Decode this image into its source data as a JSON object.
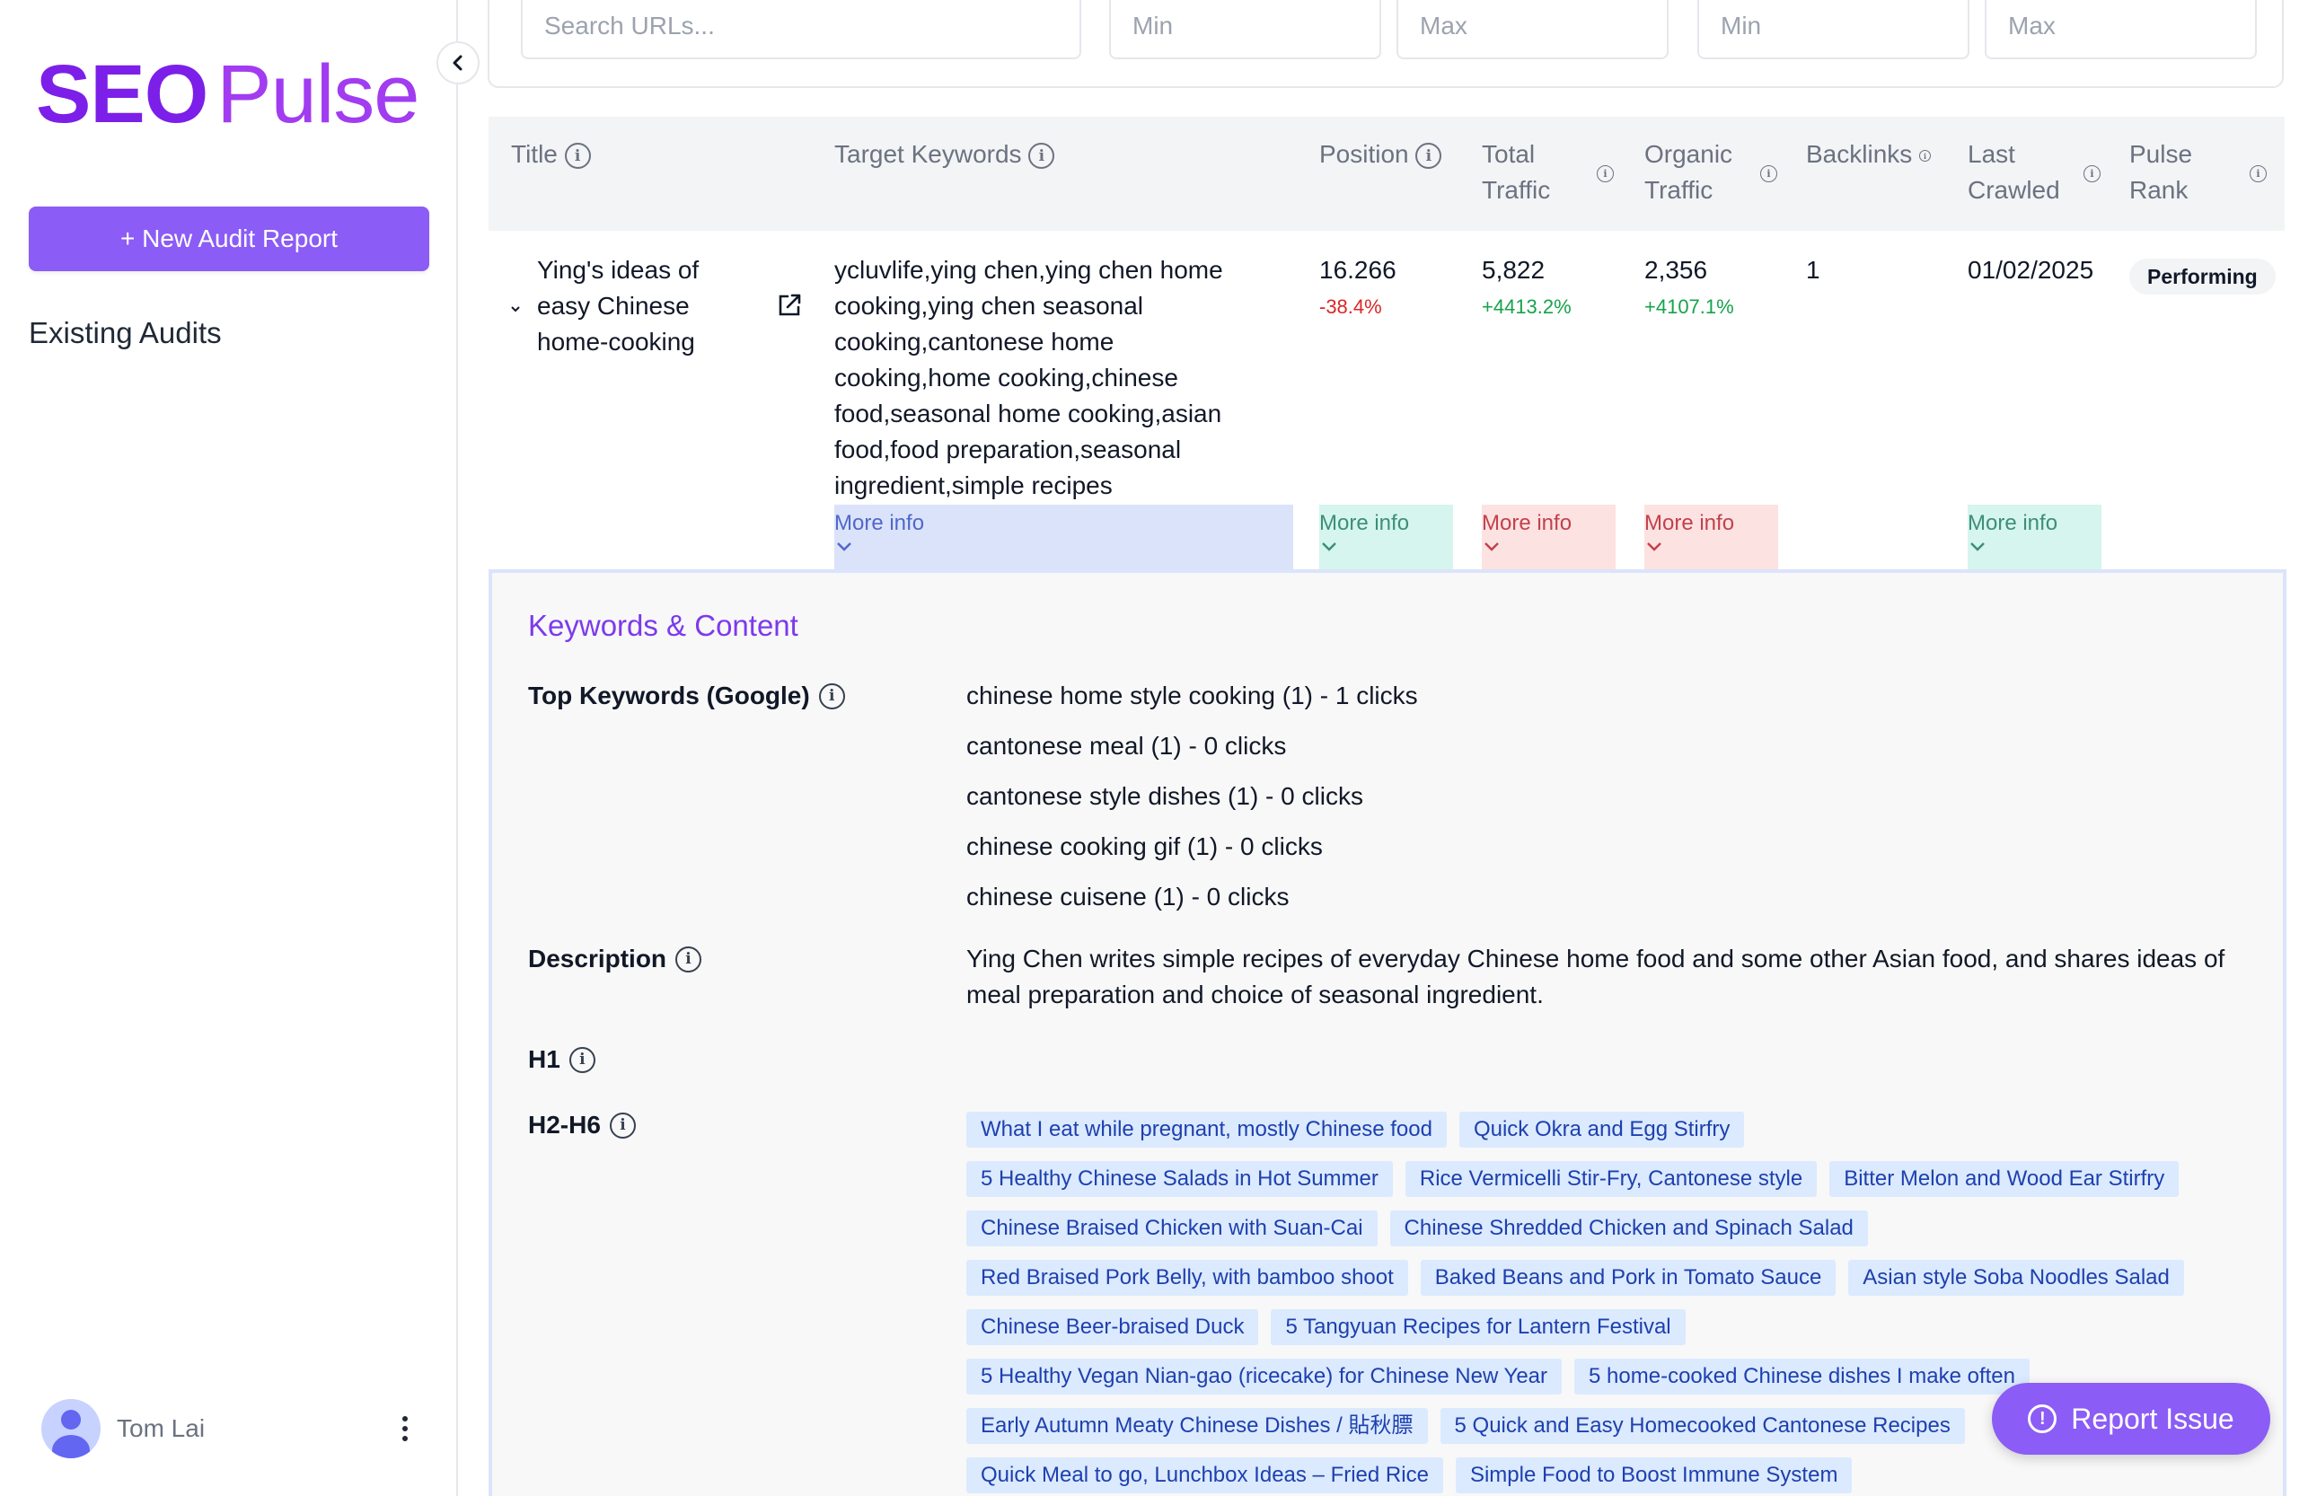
{
  "brand": {
    "name_bold": "SEO",
    "name_light": "Pulse",
    "primary": "#8b5cf6",
    "logo_color": "#7c1fe8"
  },
  "sidebar": {
    "new_audit_label": "+ New Audit Report",
    "existing_audits_label": "Existing Audits",
    "user_name": "Tom Lai"
  },
  "filters": {
    "search_placeholder": "Search URLs...",
    "min1_placeholder": "Min",
    "max1_placeholder": "Max",
    "min2_placeholder": "Min",
    "max2_placeholder": "Max"
  },
  "table": {
    "headers": {
      "title": "Title",
      "target_keywords": "Target Keywords",
      "position": "Position",
      "total_traffic": "Total Traffic",
      "organic_traffic": "Organic Traffic",
      "backlinks": "Backlinks",
      "last_crawled": "Last Crawled",
      "pulse_rank": "Pulse Rank"
    },
    "row": {
      "title": "Ying's ideas of easy Chinese home-cooking",
      "target_keywords": "ycluvlife,ying chen,ying chen home cooking,ying chen seasonal cooking,cantonese home cooking,home cooking,chinese food,seasonal home cooking,asian food,food preparation,seasonal ingredient,simple recipes",
      "position": "16.266",
      "position_delta": "-38.4%",
      "total_traffic": "5,822",
      "total_traffic_delta": "+4413.2%",
      "organic_traffic": "2,356",
      "organic_traffic_delta": "+4107.1%",
      "backlinks": "1",
      "last_crawled": "01/02/2025",
      "pulse_rank": "Performing",
      "more_info_label": "More info"
    }
  },
  "detail": {
    "section_title": "Keywords & Content",
    "top_keywords_label": "Top Keywords (Google)",
    "top_keywords": [
      "chinese home style cooking (1) - 1 clicks",
      "cantonese meal (1) - 0 clicks",
      "cantonese style dishes (1) - 0 clicks",
      "chinese cooking gif (1) - 0 clicks",
      "chinese cuisene (1) - 0 clicks"
    ],
    "description_label": "Description",
    "description": "Ying Chen writes simple recipes of everyday Chinese home food and some other Asian food, and shares ideas of meal preparation and choice of seasonal ingredient.",
    "h1_label": "H1",
    "h2h6_label": "H2-H6",
    "headings": [
      [
        "What I eat while pregnant, mostly Chinese food",
        "Quick Okra and Egg Stirfry"
      ],
      [
        "5 Healthy Chinese Salads in Hot Summer",
        "Rice Vermicelli Stir-Fry, Cantonese style",
        "Bitter Melon and Wood Ear Stirfry"
      ],
      [
        "Chinese Braised Chicken with Suan-Cai",
        "Chinese Shredded Chicken and Spinach Salad"
      ],
      [
        "Red Braised Pork Belly, with bamboo shoot",
        "Baked Beans and Pork in Tomato Sauce",
        "Asian style Soba Noodles Salad"
      ],
      [
        "Chinese Beer-braised Duck",
        "5 Tangyuan Recipes for Lantern Festival"
      ],
      [
        "5 Healthy Vegan Nian-gao (ricecake) for Chinese New Year",
        "5 home-cooked Chinese dishes I make often"
      ],
      [
        "Early Autumn Meaty Chinese Dishes / 貼秋膘",
        "5 Quick and Easy Homecooked Cantonese Recipes"
      ],
      [
        "Quick Meal to go, Lunchbox Ideas – Fried Rice",
        "Simple Food to Boost Immune System"
      ]
    ]
  },
  "report_issue_label": "Report Issue"
}
